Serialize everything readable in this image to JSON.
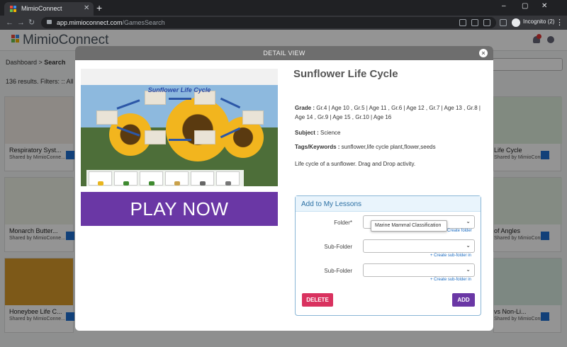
{
  "browser": {
    "tab_title": "MimioConnect",
    "tab_close": "✕",
    "new_tab": "+",
    "url_host": "app.mimioconnect.com",
    "url_path": "/GamesSearch",
    "incognito_label": "Incognito (2)",
    "window_controls": [
      "–",
      "▢",
      "✕"
    ]
  },
  "site": {
    "logo_text": "MimioConnect",
    "breadcrumb_home": "Dashboard",
    "breadcrumb_sep": " > ",
    "breadcrumb_current": "Search",
    "results_text": "136  results.  Filters: :: All G"
  },
  "cards_left": [
    {
      "title": "Respiratory Syst...",
      "shared": "Shared by MimioConne..."
    },
    {
      "title": "Monarch Butter...",
      "shared": "Shared by MimioConne..."
    },
    {
      "title": "Honeybee Life C...",
      "shared": "Shared by MimioConne..."
    }
  ],
  "cards_right": [
    {
      "title": "Life Cycle",
      "shared": "Shared by MimioConne..."
    },
    {
      "title": "of Angles",
      "shared": "Shared by MimioConne..."
    },
    {
      "title": "vs Non-Li...",
      "shared": "Shared by MimioConne..."
    }
  ],
  "modal": {
    "header": "DETAIL VIEW",
    "close": "×",
    "preview_title": "Sunflower Life Cycle",
    "play_label": "PLAY NOW",
    "resource_title": "Sunflower Life Cycle",
    "grade_label": "Grade :",
    "grade_value": " Gr.4 | Age 10 , Gr.5 | Age 11 , Gr.6 | Age 12 , Gr.7 | Age 13 , Gr.8 | Age 14 , Gr.9 | Age 15 , Gr.10 | Age 16",
    "subject_label": "Subject :",
    "subject_value": " Science",
    "tags_label": "Tags/Keywords :",
    "tags_value": " sunflower,life cycle plant,flower,seeds",
    "description": "Life cycle of a sunflower. Drag and Drop activity."
  },
  "lessons": {
    "title": "Add to My Lessons",
    "folder_label": "Folder*",
    "folder_tooltip": "Marine Mammal Classification",
    "create_folder": "Create folder",
    "subfolder_label": "Sub-Folder",
    "create_subfolder": "+ Create sub-folder in",
    "delete_label": "DELETE",
    "add_label": "ADD",
    "chevron": "⌄"
  },
  "colors": {
    "accent_purple": "#6a37a5",
    "delete_red": "#d9325f",
    "link_blue": "#1a6bc1"
  }
}
